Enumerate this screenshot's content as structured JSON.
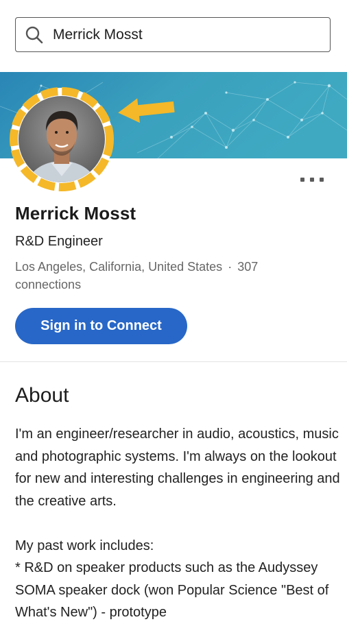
{
  "search": {
    "value": "Merrick Mosst",
    "icon": "search-icon"
  },
  "banner": {
    "colors": [
      "#1f7fb3",
      "#3aa3bf",
      "#45b3c4"
    ],
    "avatar_ring_color": "#f4b829",
    "arrow_color": "#f4b829"
  },
  "profile": {
    "name": "Merrick Mosst",
    "headline": "R&D Engineer",
    "location": "Los Angeles, California, United States",
    "separator": "·",
    "connections_count": "307",
    "connections_label": "connections",
    "connect_button": "Sign in to Connect",
    "more_icon": "more-options-icon"
  },
  "about": {
    "title": "About",
    "paragraph1": "I'm an engineer/researcher in audio, acoustics, music and photographic systems. I'm always on the lookout for new and interesting challenges in engineering and the creative arts.",
    "line_past_work": "My past work includes:",
    "line_item1": "* R&D on speaker products such as the Audyssey SOMA speaker dock (won Popular Science \"Best of What's New\") - prototype"
  },
  "colors": {
    "accent_blue": "#2867c7",
    "text_secondary": "#666666"
  }
}
